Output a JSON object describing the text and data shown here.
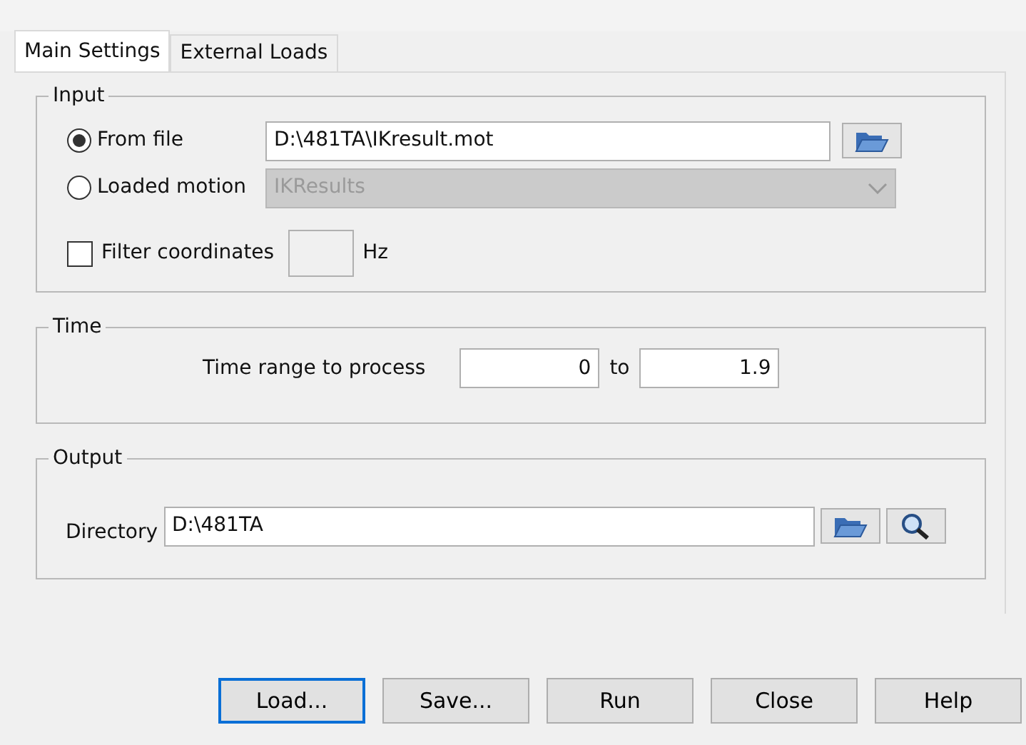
{
  "tabs": [
    {
      "label": "Main Settings",
      "selected": true
    },
    {
      "label": "External Loads",
      "selected": false
    }
  ],
  "input": {
    "title": "Input",
    "sources": [
      {
        "kind": "file",
        "label": "From file",
        "selected": true,
        "value": "D:\\481TA\\IKresult.mot"
      },
      {
        "kind": "combo",
        "label": "Loaded motion",
        "selected": false,
        "value": "IKResults",
        "disabled": true
      }
    ],
    "filter": {
      "label": "Filter coordinates",
      "checked": false,
      "unit": "Hz"
    }
  },
  "time": {
    "title": "Time",
    "label": "Time range to process",
    "from": "0",
    "separator": "to",
    "to": "1.9"
  },
  "output": {
    "title": "Output",
    "label": "Directory",
    "value": "D:\\481TA"
  },
  "buttons": [
    {
      "label": "Load...",
      "focused": true
    },
    {
      "label": "Save...",
      "focused": false
    },
    {
      "label": "Run",
      "focused": false
    },
    {
      "label": "Close",
      "focused": false
    },
    {
      "label": "Help",
      "focused": false
    }
  ]
}
